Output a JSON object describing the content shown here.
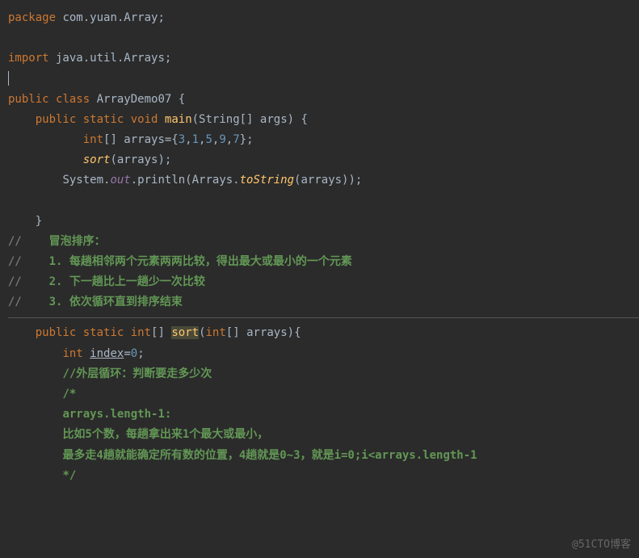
{
  "code": {
    "line1_package": "package",
    "line1_pkg_name": " com.yuan.Array;",
    "line3_import": "import",
    "line3_pkg": " java.util.Arrays;",
    "line5_public": "public ",
    "line5_class": "class ",
    "line5_name": "ArrayDemo07 {",
    "line6_indent": "    ",
    "line6_public": "public ",
    "line6_static": "static ",
    "line6_void": "void ",
    "line6_main": "main",
    "line6_params": "(String[] args) {",
    "line7_indent": "           ",
    "line7_int": "int",
    "line7_arr": "[] arrays={",
    "line7_n1": "3",
    "line7_c1": ",",
    "line7_n2": "1",
    "line7_c2": ",",
    "line7_n3": "5",
    "line7_c3": ",",
    "line7_n4": "9",
    "line7_c4": ",",
    "line7_n5": "7",
    "line7_end": "};",
    "line8_indent": "           ",
    "line8_sort": "sort",
    "line8_args": "(arrays);",
    "line9_indent": "        ",
    "line9_sys": "System.",
    "line9_out": "out",
    "line9_print": ".println(Arrays.",
    "line9_tostr": "toString",
    "line9_end": "(arrays));",
    "line11_brace": "    }",
    "c1_slash": "//",
    "c1_text": "    冒泡排序：",
    "c2_slash": "//",
    "c2_text": "    1. 每趟相邻两个元素两两比较，得出最大或最小的一个元素",
    "c3_slash": "//",
    "c3_text": "    2. 下一趟比上一趟少一次比较",
    "c4_slash": "//",
    "c4_text": "    3. 依次循环直到排序结束",
    "m1_indent": "    ",
    "m1_public": "public ",
    "m1_static": "static ",
    "m1_int": "int",
    "m1_arr": "[] ",
    "m1_sort": "sort",
    "m1_paren": "(",
    "m1_int2": "int",
    "m1_params": "[] arrays){",
    "m2_indent": "        ",
    "m2_int": "int ",
    "m2_index": "index",
    "m2_eq": "=",
    "m2_zero": "0",
    "m2_semi": ";",
    "m3_indent": "        ",
    "m3_text": "//外层循环：判断要走多少次",
    "m4_indent": "        ",
    "m4_text": "/*",
    "m5_indent": "        ",
    "m5_text": "arrays.length-1:",
    "m6_indent": "        ",
    "m6_text": "比如5个数，每趟拿出来1个最大或最小，",
    "m7_indent": "        ",
    "m7_text": "最多走4趟就能确定所有数的位置，4趟就是0~3，就是i=0;i<arrays.length-1",
    "m8_indent": "        ",
    "m8_text": "*/"
  },
  "watermark": "@51CTO博客"
}
